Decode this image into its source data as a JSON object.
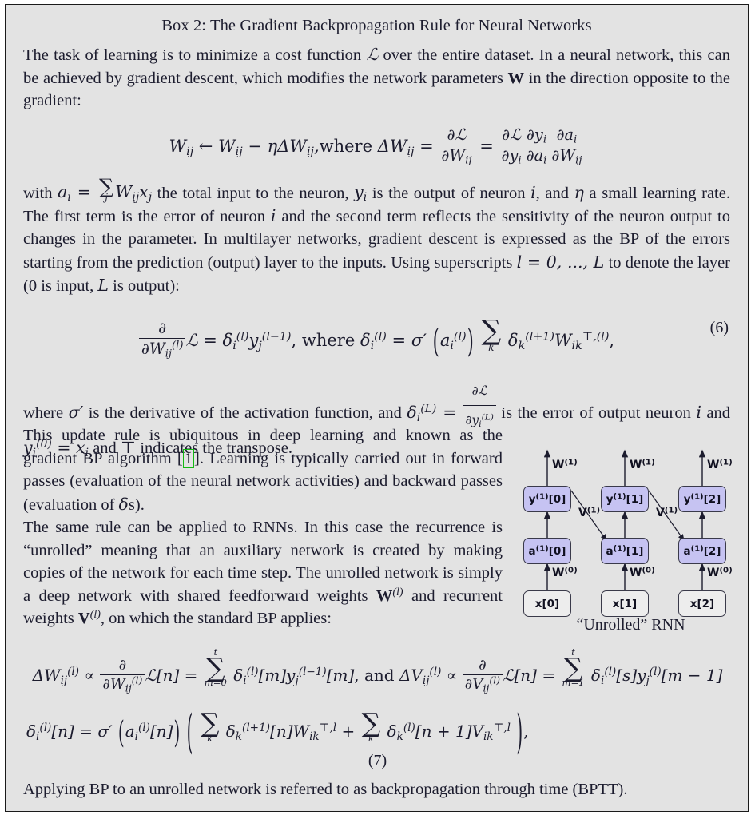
{
  "box": {
    "title": "Box 2:  The Gradient Backpropagation Rule for Neural Networks",
    "background_color": "#e3e3e3",
    "border_color": "#1a1a1a",
    "link_box_color": "#13b913",
    "node_fill_active": "#c6c3f2",
    "node_fill_input": "#ededed"
  },
  "paragraphs": {
    "p1_a": "The task of learning is to minimize a cost function ",
    "p1_b": " over the entire dataset. In a neural network, this can be achieved by gradient descent, which modifies the network parameters ",
    "p1_c": " in the direction opposite to the gradient:",
    "p2_a": "with ",
    "p2_b": " the total input to the neuron, ",
    "p2_c": " is the output of neuron ",
    "p2_d": ", and ",
    "p2_e": " a small learning rate. The first term is the error of neuron ",
    "p2_f": " and the second term reflects the sensitivity of the neuron output to changes in the parameter. In multilayer networks, gradient descent is expressed as the BP of the errors starting from the prediction (output) layer to the inputs. Using superscripts ",
    "p2_g": " to denote the layer (0 is input, ",
    "p2_h": " is output):",
    "p3_a": "where ",
    "p3_b": " is the derivative of the activation function, and ",
    "p3_c": " is the error of output neuron ",
    "p3_d": " and ",
    "p3_e": " and ⊤ indicates the transpose.",
    "p4_a": "This update rule is ubiquitous in deep learning and known as the gradient BP algorithm [",
    "p4_cite": "1",
    "p4_b": "]. Learning is typically carried out in forward passes (evaluation of the neural network activities) and backward passes (evaluation of ",
    "p4_c": "s).",
    "p5_a": "The same rule can be applied to RNNs. In this case the recurrence is “unrolled” meaning that an auxiliary network is created by making copies of the network for each time step. The unrolled network is simply a deep network with shared feedforward weights ",
    "p5_b": " and recurrent weights ",
    "p5_c": ", on which the standard BP applies:",
    "p6": "Applying BP to an unrolled network is referred to as backpropagation through time (BPTT)."
  },
  "equations": {
    "eq_update_number": "",
    "eq6_number": "(6)",
    "eq7_number": "(7)",
    "where_label": "where",
    "where_label2": ", where",
    "and_label": ", and"
  },
  "figure": {
    "caption": "“Unrolled” RNN",
    "columns": [
      {
        "input": "x[0]",
        "activation": "a(1)[0]",
        "output": "y(1)[0]"
      },
      {
        "input": "x[1]",
        "activation": "a(1)[1]",
        "output": "y(1)[1]"
      },
      {
        "input": "x[2]",
        "activation": "a(1)[2]",
        "output": "y(1)[2]"
      }
    ],
    "node_labels": {
      "x0": "x[0]",
      "x1": "x[1]",
      "x2": "x[2]",
      "a0_base": "a",
      "a0_sup": "(1)",
      "a0_idx": "[0]",
      "a1_idx": "[1]",
      "a2_idx": "[2]",
      "y_base": "y",
      "y_sup": "(1)",
      "y0_idx": "[0]",
      "y1_idx": "[1]",
      "y2_idx": "[2]"
    },
    "weight_labels": {
      "w0_base": "W",
      "w0_sup": "(0)",
      "w1_base": "W",
      "w1_sup": "(1)",
      "v1_base": "V",
      "v1_sup": "(1)"
    }
  }
}
